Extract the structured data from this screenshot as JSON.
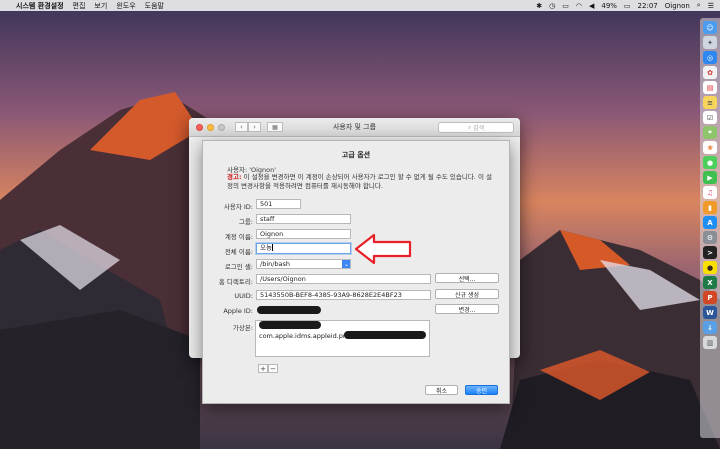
{
  "menubar": {
    "apple": "",
    "app_name": "시스템 환경설정",
    "menus": [
      "편집",
      "보기",
      "윈도우",
      "도움말"
    ],
    "battery": "49%",
    "time": "22:07",
    "user": "Oignon"
  },
  "bg_window": {
    "title": "사용자 및 그룹",
    "search_placeholder": "검색"
  },
  "sheet": {
    "title": "고급 옵션",
    "user_line": "사용자: 'Oignon'",
    "warning_label": "경고:",
    "warning_text": " 이 설정을 변경하면 이 계정이 손상되어 사용자가 로그인 할 수 없게 될 수도 있습니다. 이 설정의 변경사항을 적용하려면 컴퓨터를 재시동해야 합니다.",
    "fields": {
      "user_id_label": "사용자 ID:",
      "user_id_value": "501",
      "group_label": "그룹:",
      "group_value": "staff",
      "account_label": "계정 이름:",
      "account_value": "Oignon",
      "fullname_label": "전체 이름:",
      "fullname_value": "오뇽",
      "shell_label": "로그인 셸:",
      "shell_value": "/bin/bash",
      "home_label": "홈 디렉토리:",
      "home_value": "/Users/Oignon",
      "uuid_label": "UUID:",
      "uuid_value": "5143550B-BEF8-4385-93A9-8628E2E4BF23",
      "appleid_label": "Apple ID:",
      "alias_label": "가상본:",
      "alias_value": "com.apple.idms.appleid.prd."
    },
    "buttons": {
      "choose": "선택...",
      "create_new": "신규 생성",
      "change": "변경...",
      "cancel": "취소",
      "ok": "승인",
      "plus": "+",
      "minus": "−"
    }
  },
  "colors": {
    "annotation_arrow": "#e8202a",
    "accent": "#1a82fb",
    "warning": "#cc1d1d"
  },
  "dock": {
    "icons": [
      "finder-icon",
      "launchpad-icon",
      "safari-icon",
      "photos-icon",
      "calendar-icon",
      "notes-icon",
      "reminders-icon",
      "maps-icon",
      "photos-app-icon",
      "messages-icon",
      "facetime-icon",
      "itunes-icon",
      "ibooks-icon",
      "appstore-icon",
      "system-preferences-icon",
      "terminal-icon",
      "kakaotalk-icon",
      "excel-icon",
      "powerpoint-icon",
      "word-icon",
      "downloads-icon",
      "trash-icon"
    ]
  }
}
